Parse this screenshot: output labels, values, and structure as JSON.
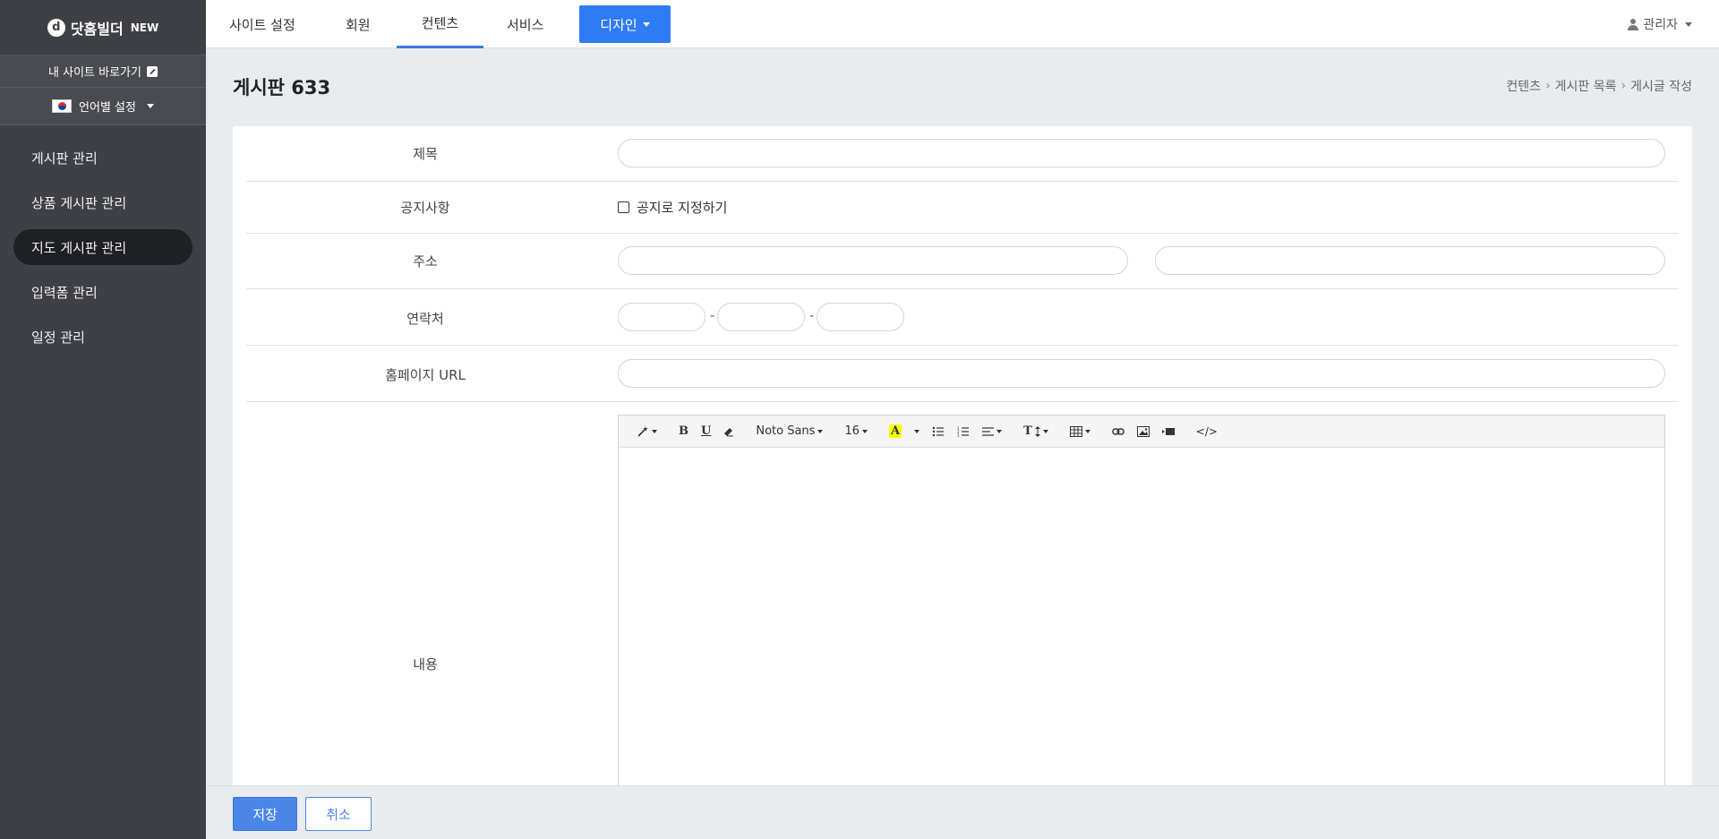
{
  "sidebar": {
    "brand": "닷홈빌더",
    "brand_badge": "NEW",
    "site_link": "내 사이트 바로가기",
    "lang_label": "언어별 설정",
    "items": [
      {
        "label": "게시판 관리"
      },
      {
        "label": "상품 게시판 관리"
      },
      {
        "label": "지도 게시판 관리"
      },
      {
        "label": "입력폼 관리"
      },
      {
        "label": "일정 관리"
      }
    ],
    "active_index": 2
  },
  "topnav": {
    "tabs": [
      {
        "label": "사이트 설정"
      },
      {
        "label": "회원"
      },
      {
        "label": "컨텐츠"
      },
      {
        "label": "서비스"
      }
    ],
    "active_tab": "컨텐츠",
    "design_button": "디자인",
    "admin_label": "관리자"
  },
  "page": {
    "title": "게시판 633",
    "breadcrumb": [
      "컨텐츠",
      "게시판 목록",
      "게시글 작성"
    ]
  },
  "form": {
    "title_label": "제목",
    "notice_label": "공지사항",
    "notice_checkbox": "공지로 지정하기",
    "address_label": "주소",
    "contact_label": "연락처",
    "contact_sep": "-",
    "homepage_label": "홈페이지 URL",
    "content_label": "내용"
  },
  "editor": {
    "font_name": "Noto Sans",
    "font_size": "16",
    "bold": "B",
    "underline": "U",
    "highlight": "A",
    "codeview": "</>",
    "text_style": "T"
  },
  "actions": {
    "save": "저장",
    "cancel": "취소"
  },
  "colors": {
    "sidebar_bg": "#3f4045",
    "accent": "#2f7bf5",
    "save_button": "#4a86e8"
  }
}
